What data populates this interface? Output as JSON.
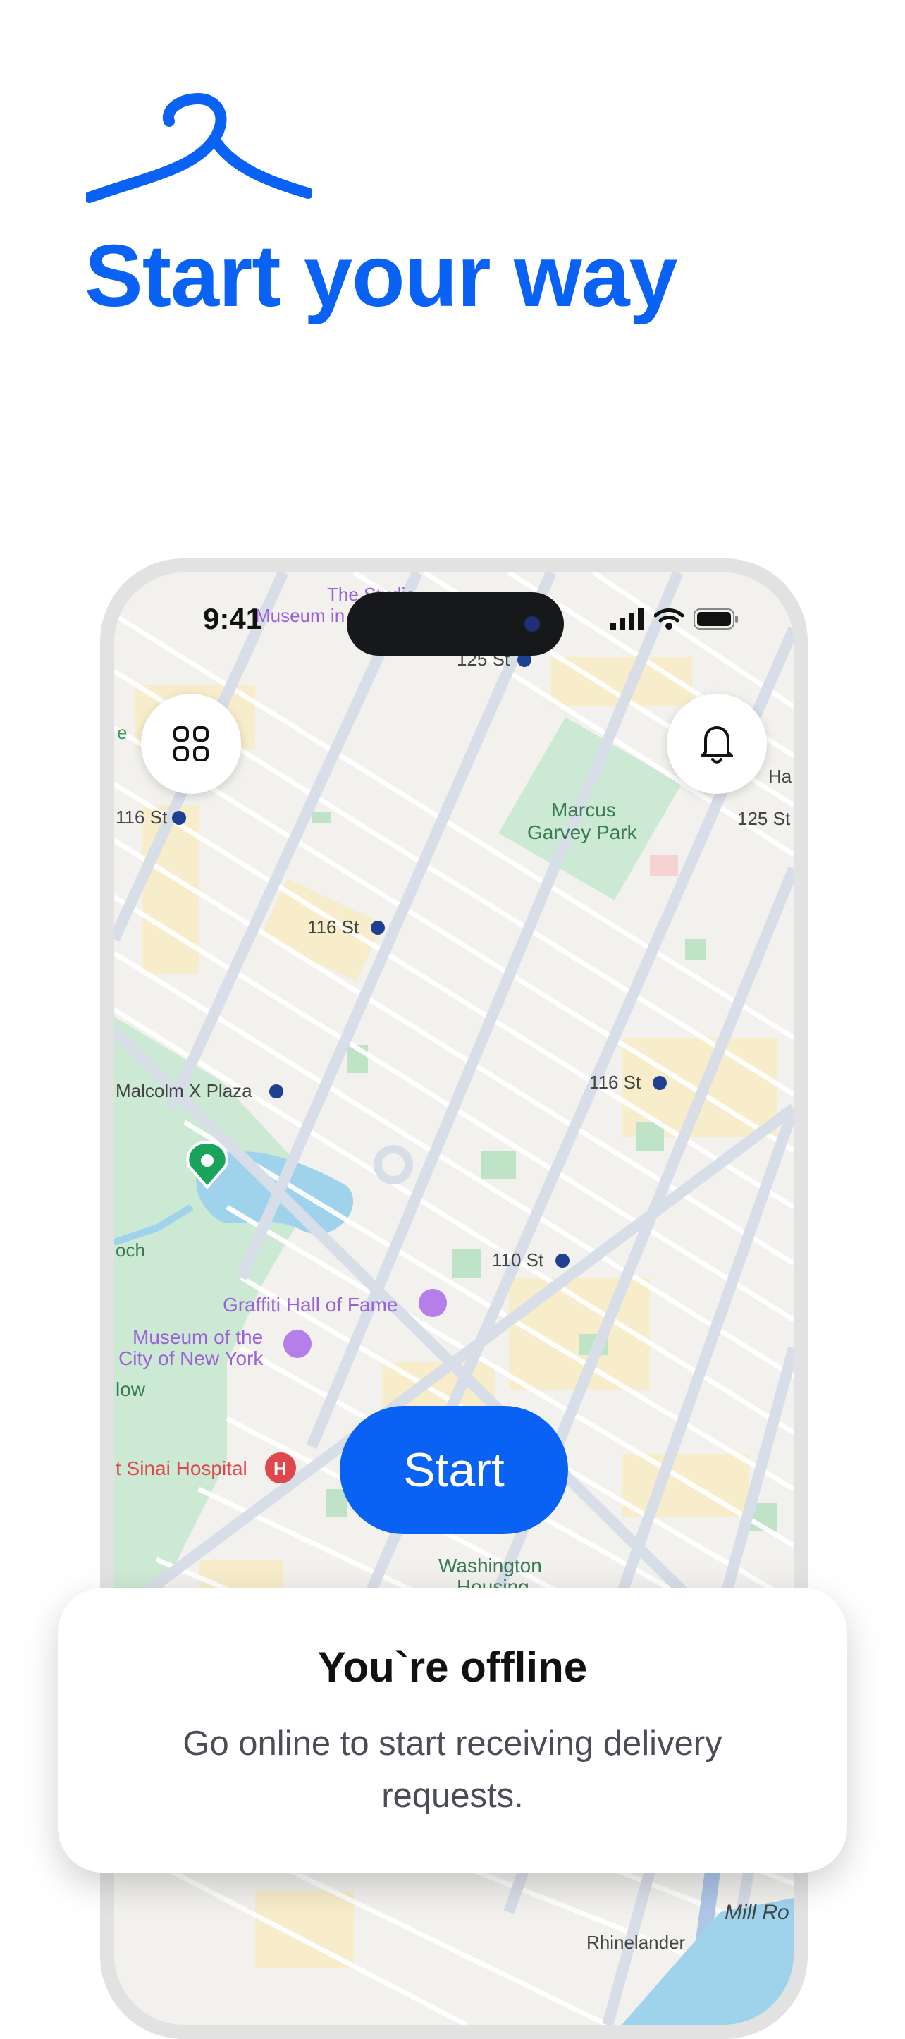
{
  "headline": "Start your way",
  "status_bar": {
    "time": "9:41"
  },
  "map_labels": {
    "studio_museum_1": "The Studio",
    "studio_museum_2": "Museum in",
    "st125_top": "125 St",
    "st116_left": "116 St",
    "ha": "Ha",
    "st125_right": "125 St",
    "marcus_1": "Marcus",
    "marcus_2": "Garvey Park",
    "st116_mid": "116 St",
    "malcolm": "Malcolm X Plaza",
    "st116_right": "116 St",
    "st110": "110 St",
    "graffiti": "Graffiti Hall of Fame",
    "museum_1": "Museum of the",
    "museum_2": "City of New York",
    "low": "low",
    "sinai": "t Sinai Hospital",
    "washington_1": "Washington",
    "washington_2": "Housing",
    "mill": "Mill Ro",
    "rhinelander": "Rhinelander",
    "e": "e",
    "och": "och"
  },
  "start_button": "Start",
  "offline_card": {
    "title": "You`re offline",
    "message": "Go online to start receiving delivery requests."
  },
  "colors": {
    "brand": "#0a62f5",
    "park": "#cbe9d3",
    "water": "#9fd3ec"
  }
}
